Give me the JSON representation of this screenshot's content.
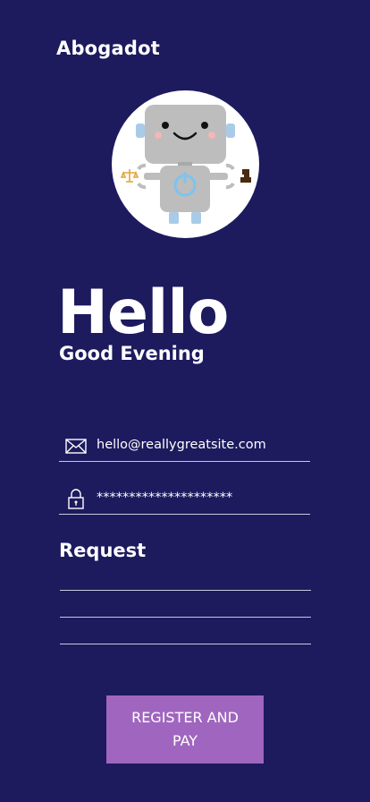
{
  "brand": {
    "name": "Abogadot"
  },
  "avatar": {
    "icon": "robot-mascot-icon"
  },
  "hero": {
    "title": "Hello",
    "greeting": "Good Evening"
  },
  "form": {
    "email": {
      "value": "hello@reallygreatsite.com",
      "icon": "envelope-icon"
    },
    "password": {
      "value": "*********************",
      "icon": "lock-icon"
    },
    "request": {
      "label": "Request"
    },
    "submit_label": "REGISTER AND PAY"
  },
  "colors": {
    "background": "#1d1a5e",
    "button": "#a066bf",
    "line": "#c9c8df"
  }
}
